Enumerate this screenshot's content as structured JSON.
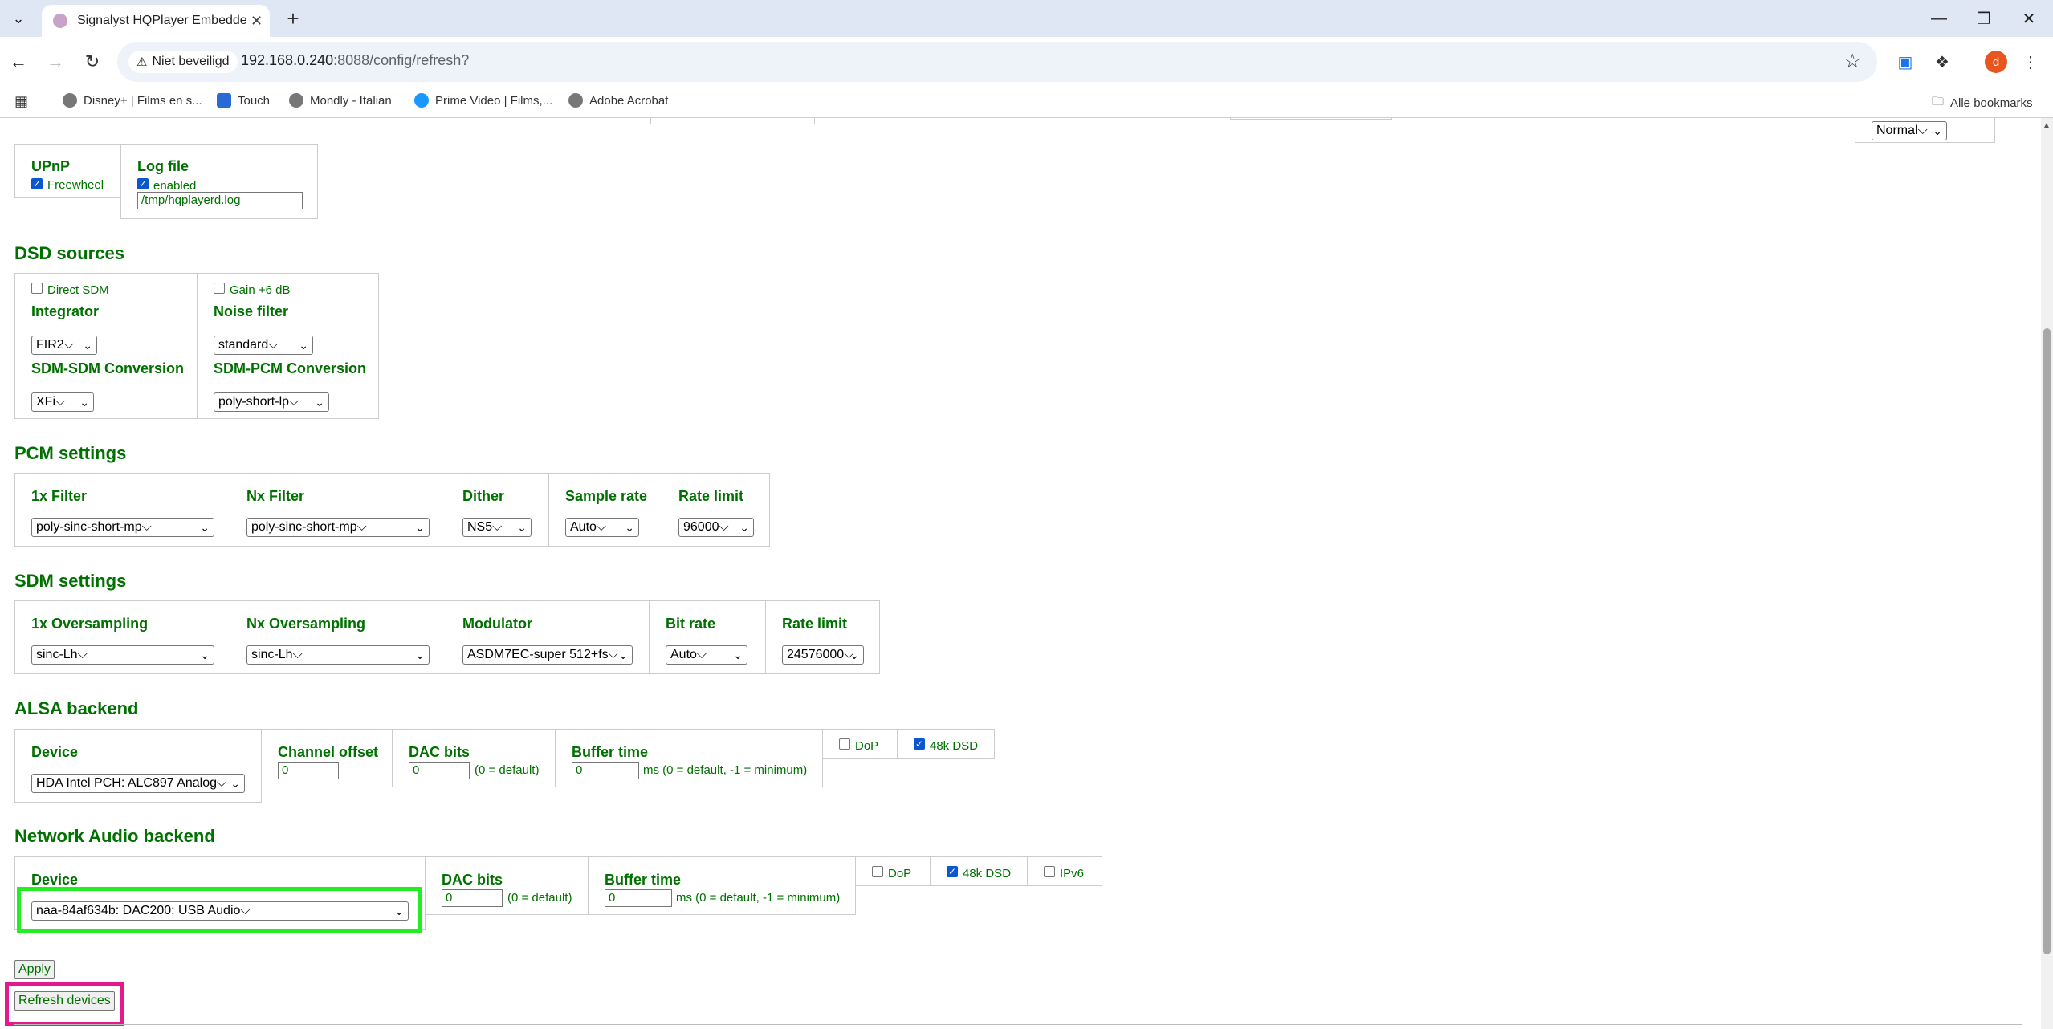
{
  "browser": {
    "tab_title": "Signalyst HQPlayer Embedded",
    "security_label": "Niet beveiligd",
    "url_host": "192.168.0.240",
    "url_rest": ":8088/config/refresh?",
    "avatar_letter": "d",
    "bookmarks": [
      "Disney+ | Films en s...",
      "Touch",
      "Mondly  - Italian",
      "Prime Video | Films,...",
      "Adobe Acrobat"
    ],
    "all_bookmarks": "Alle bookmarks"
  },
  "top": {
    "output_mode": "Normal",
    "upnp": {
      "label": "UPnP",
      "freewheel": "Freewheel",
      "freewheel_checked": true
    },
    "log": {
      "label": "Log file",
      "enabled": "enabled",
      "enabled_checked": true,
      "path": "/tmp/hqplayerd.log"
    }
  },
  "dsd": {
    "heading": "DSD sources",
    "direct_sdm": "Direct SDM",
    "gain": "Gain +6 dB",
    "integrator_label": "Integrator",
    "integrator": "FIR2",
    "noise_filter_label": "Noise filter",
    "noise_filter": "standard",
    "sdm_sdm_label": "SDM-SDM Conversion",
    "sdm_sdm": "XFi",
    "sdm_pcm_label": "SDM-PCM Conversion",
    "sdm_pcm": "poly-short-lp"
  },
  "pcm": {
    "heading": "PCM settings",
    "filter1x_label": "1x Filter",
    "filter1x": "poly-sinc-short-mp",
    "filterNx_label": "Nx Filter",
    "filterNx": "poly-sinc-short-mp",
    "dither_label": "Dither",
    "dither": "NS5",
    "samplerate_label": "Sample rate",
    "samplerate": "Auto",
    "ratelimit_label": "Rate limit",
    "ratelimit": "96000"
  },
  "sdm": {
    "heading": "SDM settings",
    "os1x_label": "1x Oversampling",
    "os1x": "sinc-Lh",
    "osNx_label": "Nx Oversampling",
    "osNx": "sinc-Lh",
    "modulator_label": "Modulator",
    "modulator": "ASDM7EC-super 512+fs",
    "bitrate_label": "Bit rate",
    "bitrate": "Auto",
    "ratelimit_label": "Rate limit",
    "ratelimit": "24576000"
  },
  "alsa": {
    "heading": "ALSA backend",
    "device_label": "Device",
    "device": "HDA Intel PCH: ALC897 Analog",
    "channel_offset_label": "Channel offset",
    "channel_offset": "0",
    "dac_bits_label": "DAC bits",
    "dac_bits": "0",
    "dac_bits_note": "(0 = default)",
    "buffer_label": "Buffer time",
    "buffer": "0",
    "buffer_note": "ms (0 = default, -1 = minimum)",
    "dop": "DoP",
    "dsd48k": "48k DSD"
  },
  "network": {
    "heading": "Network Audio backend",
    "device_label": "Device",
    "device": "naa-84af634b: DAC200: USB Audio",
    "dac_bits_label": "DAC bits",
    "dac_bits": "0",
    "dac_bits_note": "(0 = default)",
    "buffer_label": "Buffer time",
    "buffer": "0",
    "buffer_note": "ms (0 = default, -1 = minimum)",
    "dop": "DoP",
    "dsd48k": "48k DSD",
    "ipv6": "IPv6"
  },
  "actions": {
    "apply": "Apply",
    "refresh": "Refresh devices"
  }
}
